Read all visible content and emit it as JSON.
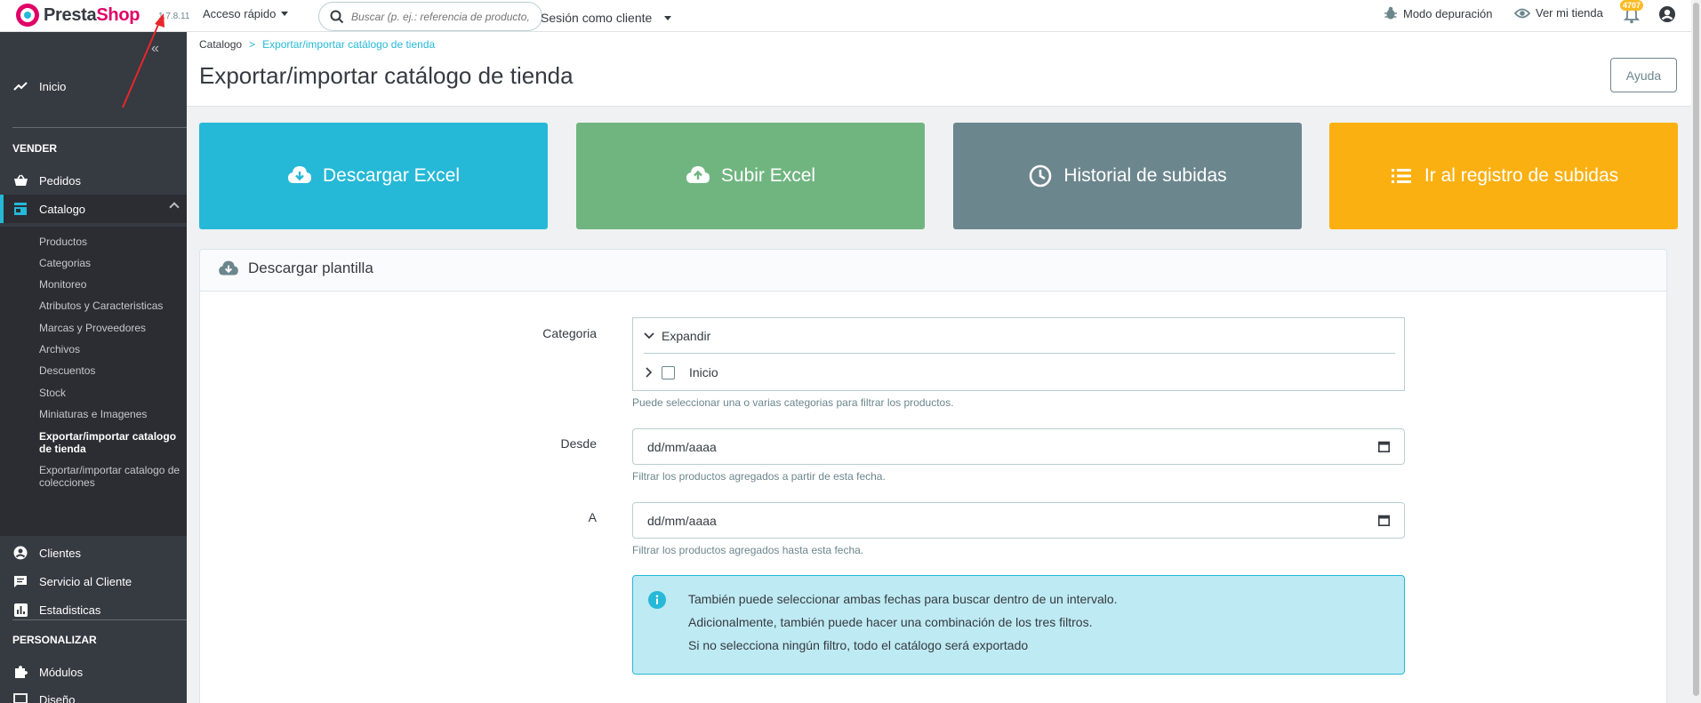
{
  "header": {
    "logo_part1": "Presta",
    "logo_part2": "Shop",
    "version": "1.7.8.11",
    "quick_access": "Acceso rápido",
    "search_placeholder": "Buscar (p. ej.: referencia de producto,",
    "session_label": "Sesión como cliente",
    "debug_label": "Modo depuración",
    "view_store_label": "Ver mi tienda",
    "notifications_count": "4707"
  },
  "sidebar": {
    "home": "Inicio",
    "sell_title": "VENDER",
    "orders": "Pedidos",
    "catalog": "Catalogo",
    "catalog_items": [
      "Productos",
      "Categorias",
      "Monitoreo",
      "Atributos y Caracteristicas",
      "Marcas y Proveedores",
      "Archivos",
      "Descuentos",
      "Stock",
      "Miniaturas e Imagenes",
      "Exportar/importar catalogo de tienda",
      "Exportar/importar catalogo de colecciones"
    ],
    "clients": "Clientes",
    "customer_service": "Servicio al Cliente",
    "stats": "Estadisticas",
    "customize_title": "PERSONALIZAR",
    "modules": "Módulos",
    "design": "Diseño"
  },
  "page": {
    "breadcrumb_root": "Catalogo",
    "breadcrumb_sep": ">",
    "breadcrumb_current": "Exportar/importar catálogo de tienda",
    "title": "Exportar/importar catálogo de tienda",
    "help_button": "Ayuda"
  },
  "tiles": {
    "download": "Descargar Excel",
    "upload": "Subir Excel",
    "history": "Historial de subidas",
    "log": "Ir al registro de subidas"
  },
  "colors": {
    "download": "#25b9d7",
    "upload": "#70b580",
    "history": "#6c868e",
    "log": "#fbb012"
  },
  "panel": {
    "title": "Descargar plantilla",
    "category_label": "Categoria",
    "expand": "Expandir",
    "tree_root": "Inicio",
    "category_help": "Puede seleccionar una o varias categorias para filtrar los productos.",
    "from_label": "Desde",
    "from_value": "dd/mm/aaaa",
    "from_help": "Filtrar los productos agregados a partir de esta fecha.",
    "to_label": "A",
    "to_value": "dd/mm/aaaa",
    "to_help": "Filtrar los productos agregados hasta esta fecha.",
    "info_line1": "También puede seleccionar ambas fechas para buscar dentro de un intervalo.",
    "info_line2": "Adicionalmente, también puede hacer una combinación de los tres filtros.",
    "info_line3": "Si no selecciona ningún filtro, todo el catálogo será exportado"
  }
}
